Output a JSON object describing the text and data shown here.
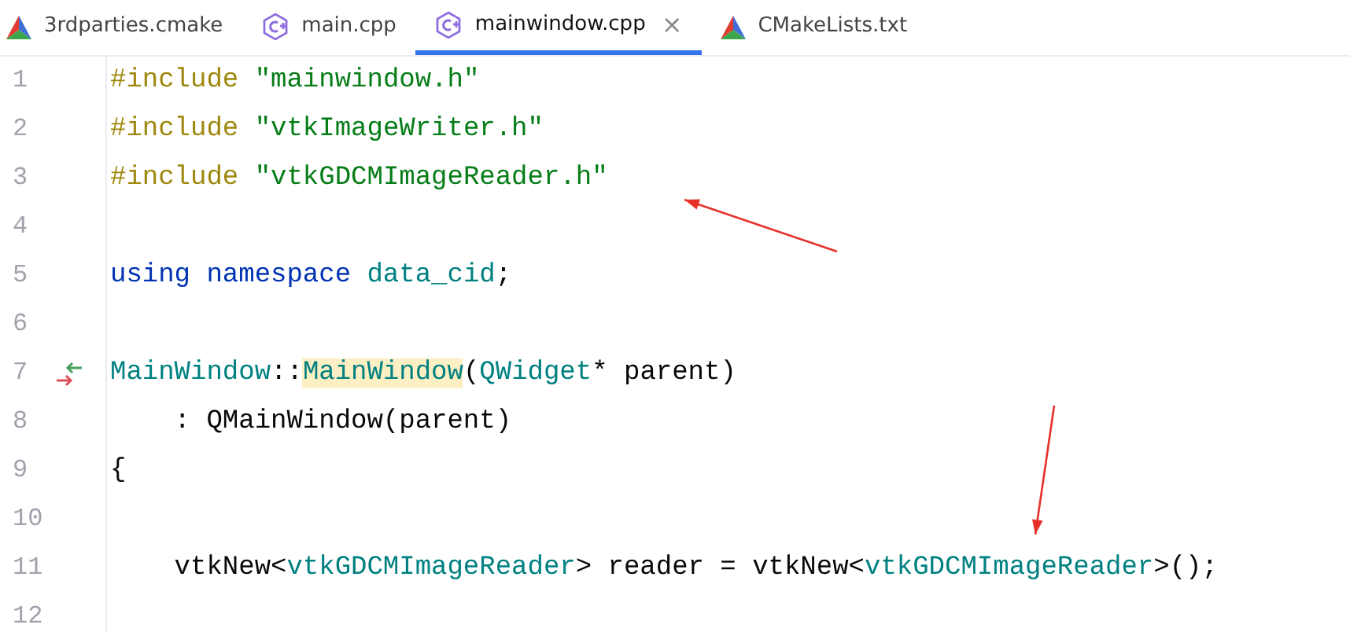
{
  "tabs": [
    {
      "label": "3rdparties.cmake",
      "kind": "cmake",
      "selected": false,
      "closable": false
    },
    {
      "label": "main.cpp",
      "kind": "cpp",
      "selected": false,
      "closable": false
    },
    {
      "label": "mainwindow.cpp",
      "kind": "cpp",
      "selected": true,
      "closable": true
    },
    {
      "label": "CMakeLists.txt",
      "kind": "cmake",
      "selected": false,
      "closable": false
    }
  ],
  "close_glyph": "×",
  "lines": [
    {
      "number": "1",
      "tokens": [
        {
          "text": "#include ",
          "kind": "pp"
        },
        {
          "text": "\"mainwindow.h\"",
          "kind": "str"
        }
      ]
    },
    {
      "number": "2",
      "tokens": [
        {
          "text": "#include ",
          "kind": "pp"
        },
        {
          "text": "\"vtkImageWriter.h\"",
          "kind": "str"
        }
      ]
    },
    {
      "number": "3",
      "tokens": [
        {
          "text": "#include ",
          "kind": "pp"
        },
        {
          "text": "\"vtkGDCMImageReader.h\"",
          "kind": "str"
        }
      ]
    },
    {
      "number": "4"
    },
    {
      "number": "5",
      "tokens": [
        {
          "text": "using namespace ",
          "kind": "kw"
        },
        {
          "text": "data_cid",
          "kind": "type"
        },
        {
          "text": ";",
          "kind": "plain"
        }
      ]
    },
    {
      "number": "6"
    },
    {
      "number": "7",
      "implementation_marker": true,
      "tokens": [
        {
          "text": "MainWindow",
          "kind": "type"
        },
        {
          "text": "::",
          "kind": "plain"
        },
        {
          "text": "MainWindow",
          "kind": "hl"
        },
        {
          "text": "(",
          "kind": "plain"
        },
        {
          "text": "QWidget",
          "kind": "type"
        },
        {
          "text": "* parent)",
          "kind": "plain"
        }
      ]
    },
    {
      "number": "8",
      "tokens": [
        {
          "text": "    : QMainWindow(parent)",
          "kind": "plain"
        }
      ]
    },
    {
      "number": "9",
      "tokens": [
        {
          "text": "{",
          "kind": "plain"
        }
      ]
    },
    {
      "number": "10"
    },
    {
      "number": "11",
      "tokens": [
        {
          "text": "    vtkNew<",
          "kind": "plain"
        },
        {
          "text": "vtkGDCMImageReader",
          "kind": "type"
        },
        {
          "text": "> reader = vtkNew<",
          "kind": "plain"
        },
        {
          "text": "vtkGDCMImageReader",
          "kind": "type"
        },
        {
          "text": ">();",
          "kind": "plain"
        }
      ]
    },
    {
      "number": "12"
    }
  ]
}
